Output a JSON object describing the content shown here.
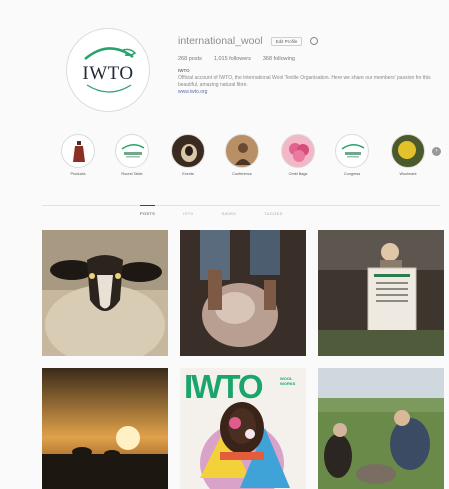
{
  "profile": {
    "username": "international_wool",
    "edit_label": "Edit Profile",
    "avatar_text": "IWTO",
    "posts": "268 posts",
    "followers": "1,015 followers",
    "following": "368 following",
    "fullname": "IWTO",
    "bio": "Official account of IWTO, the International Wool Textile Organisation. Here we share our members' passion for this beautiful, amazing natural fibre.",
    "link": "www.iwto.org"
  },
  "highlights": [
    {
      "label": "Products",
      "icon": "dress-icon"
    },
    {
      "label": "Round Table",
      "icon": "iwto-logo-icon"
    },
    {
      "label": "Events",
      "icon": "sheep-icon"
    },
    {
      "label": "Conference",
      "icon": "person-icon"
    },
    {
      "label": "Ombi Bags",
      "icon": "flower-icon"
    },
    {
      "label": "Congress",
      "icon": "iwto-logo-icon"
    },
    {
      "label": "Woolmark",
      "icon": "yellow-circle-icon"
    }
  ],
  "tabs": [
    "POSTS",
    "IGTV",
    "SAVED",
    "TAGGED"
  ],
  "active_tab": 0,
  "posts_grid": [
    {
      "name": "post-sheep-face"
    },
    {
      "name": "post-shearing"
    },
    {
      "name": "post-child-sign"
    },
    {
      "name": "post-sunset"
    },
    {
      "name": "post-iwto-magazine",
      "cover_title": "IWTO",
      "cover_tag": "WOOL WORKS"
    },
    {
      "name": "post-field-people"
    }
  ],
  "colors": {
    "accent": "#1aa56a",
    "link": "#5a6fa6"
  }
}
